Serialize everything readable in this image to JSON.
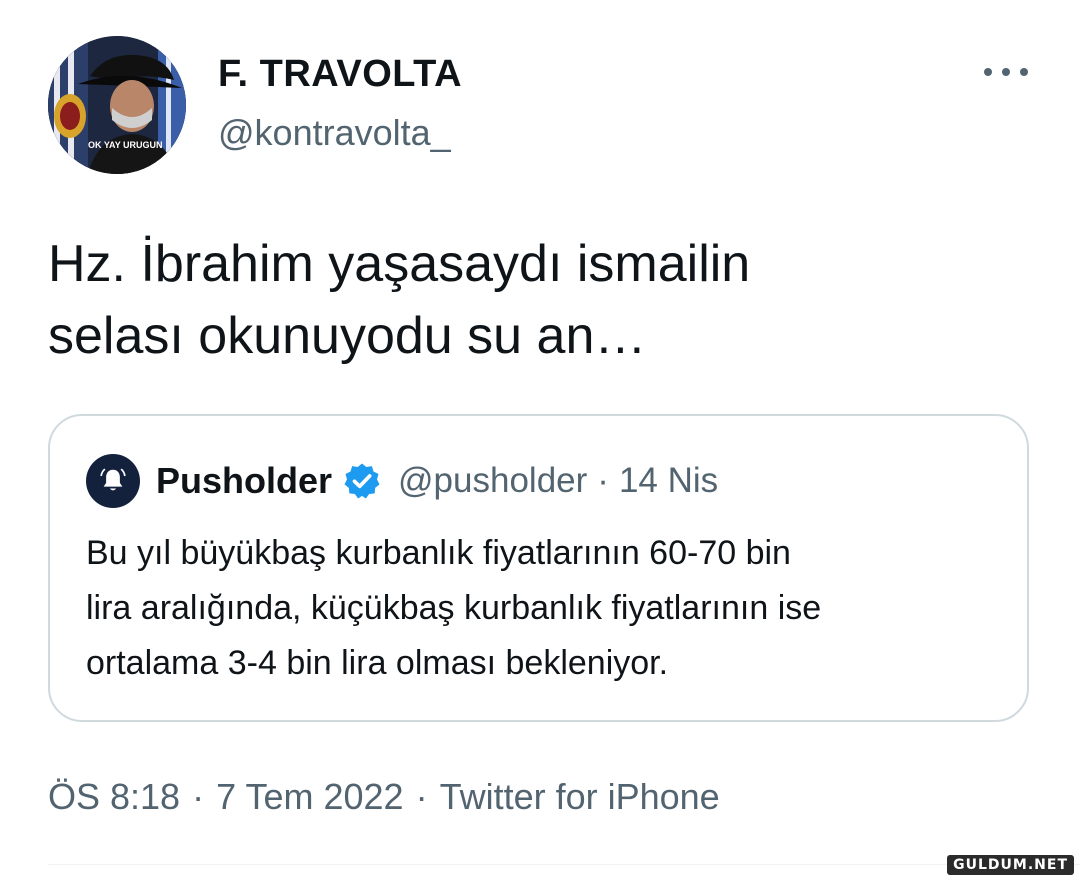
{
  "tweet": {
    "author_name": "F. TRAVOLTA",
    "author_handle": "@kontravolta_",
    "avatar_caption": "OK YAY URUGUN",
    "text_lines": [
      "Hz. İbrahim yaşasaydı ismailin",
      "selası okunuyodu su an…"
    ],
    "more_icon": "more-horizontal-icon"
  },
  "quote": {
    "name": "Pusholder",
    "verified_icon": "verified-badge-icon",
    "handle": "@pusholder",
    "separator": "·",
    "date": "14 Nis",
    "text_lines": [
      "Bu yıl büyükbaş kurbanlık fiyatlarının 60-70 bin",
      "lira aralığında, küçükbaş kurbanlık fiyatlarının ise",
      "ortalama 3-4 bin lira olması bekleniyor."
    ]
  },
  "meta": {
    "time": "ÖS 8:18",
    "separator": "·",
    "date": "7 Tem 2022",
    "source": "Twitter for iPhone"
  },
  "watermark": "GULDUM.NET",
  "colors": {
    "text": "#0f1419",
    "secondary": "#536471",
    "border": "#cfd9de",
    "verified": "#1d9bf0"
  }
}
